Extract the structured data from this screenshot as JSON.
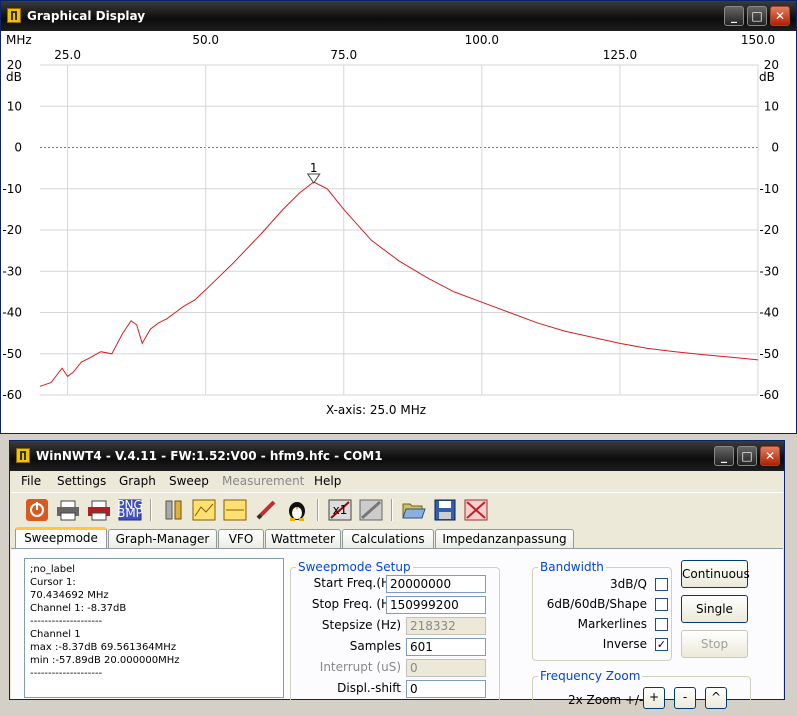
{
  "graph_window": {
    "title": "Graphical Display",
    "unit_x": "MHz",
    "unit_y": "dB",
    "x_ticks_top": [
      "50.0",
      "100.0",
      "150.0"
    ],
    "x_ticks_bottom": [
      "25.0",
      "75.0",
      "125.0"
    ],
    "y_ticks": [
      "20",
      "10",
      "0",
      "-10",
      "-20",
      "-30",
      "-40",
      "-50",
      "-60"
    ],
    "xaxis_readout": "X-axis: 25.0 MHz",
    "marker_label": "1",
    "trace_color": "#d42020",
    "buttons": {
      "minimize": "_",
      "maximize": "□",
      "close": "✕"
    }
  },
  "chart_data": {
    "type": "line",
    "xlim": [
      20.0,
      150.0
    ],
    "ylim": [
      -60,
      20
    ],
    "grid": true,
    "series": [
      {
        "x": [
          20.0,
          22,
          24,
          25,
          26,
          27.5,
          29,
          31,
          33,
          35,
          36.5,
          37.5,
          38.5,
          40,
          41.5,
          43,
          44.5,
          46,
          48,
          50,
          55,
          60,
          64,
          67,
          69.56,
          72,
          75,
          80,
          85,
          90,
          95,
          100,
          105,
          110,
          115,
          120,
          125,
          130,
          135,
          140,
          145,
          150
        ],
        "y": [
          -57.9,
          -57,
          -53.5,
          -55.5,
          -54.5,
          -52,
          -51,
          -49.5,
          -50,
          -45,
          -42,
          -43,
          -47.5,
          -44,
          -42.5,
          -41.5,
          -40,
          -38.5,
          -37,
          -34.5,
          -28,
          -21,
          -15,
          -11,
          -8.37,
          -10,
          -15,
          -22.5,
          -27.5,
          -31.5,
          -35,
          -37.5,
          -40,
          -42.5,
          -44.5,
          -46,
          -47.5,
          -48.7,
          -49.5,
          -50.2,
          -50.8,
          -51.5
        ]
      }
    ]
  },
  "main_window": {
    "title": "WinNWT4 - V.4.11 - FW:1.52:V00 - hfm9.hfc - COM1",
    "menus": [
      "File",
      "Settings",
      "Graph",
      "Sweep",
      "Measurement",
      "Help"
    ],
    "toolbar_icons": [
      "power-icon",
      "printer-icon",
      "printer-color-icon",
      "png-bmp-icon",
      "tools-icon",
      "graph-yellow-icon",
      "graph-yellow-2-icon",
      "pen-icon",
      "linux-penguin-icon",
      "scale-x1-icon",
      "scale-tools-icon",
      "folder-open-icon",
      "save-disk-icon",
      "delete-graph-icon"
    ],
    "tabs": [
      "Sweepmode",
      "Graph-Manager",
      "VFO",
      "Wattmeter",
      "Calculations",
      "Impedanzanpassung"
    ],
    "info_lines": [
      ";no_label",
      "",
      "Cursor 1:",
      "70.434692 MHz",
      "Channel 1: -8.37dB",
      "--------------------",
      "Channel 1",
      "max :-8.37dB 69.561364MHz",
      "min :-57.89dB 20.000000MHz",
      "--------------------"
    ],
    "sweep_setup": {
      "title": "Sweepmode Setup",
      "start_label": "Start Freq.(Hz)",
      "start_value": "20000000",
      "stop_label": "Stop Freq. (Hz)",
      "stop_value": "150999200",
      "step_label": "Stepsize (Hz)",
      "step_value": "218332",
      "samples_label": "Samples",
      "samples_value": "601",
      "interrupt_label": "Interrupt (uS)",
      "interrupt_value": "0",
      "displ_label": "Displ.-shift",
      "displ_value": "0"
    },
    "bandwidth": {
      "title": "Bandwidth",
      "q_label": "3dB/Q",
      "q_checked": false,
      "shape_label": "6dB/60dB/Shape",
      "shape_checked": false,
      "marker_label": "Markerlines",
      "marker_checked": false,
      "inverse_label": "Inverse",
      "inverse_checked": true
    },
    "zoom": {
      "title": "Frequency Zoom",
      "label": "2x Zoom +/-",
      "plus": "+",
      "minus": "-",
      "caret": "^"
    },
    "buttons": {
      "continuous": "Continuous",
      "single": "Single",
      "stop": "Stop"
    }
  }
}
